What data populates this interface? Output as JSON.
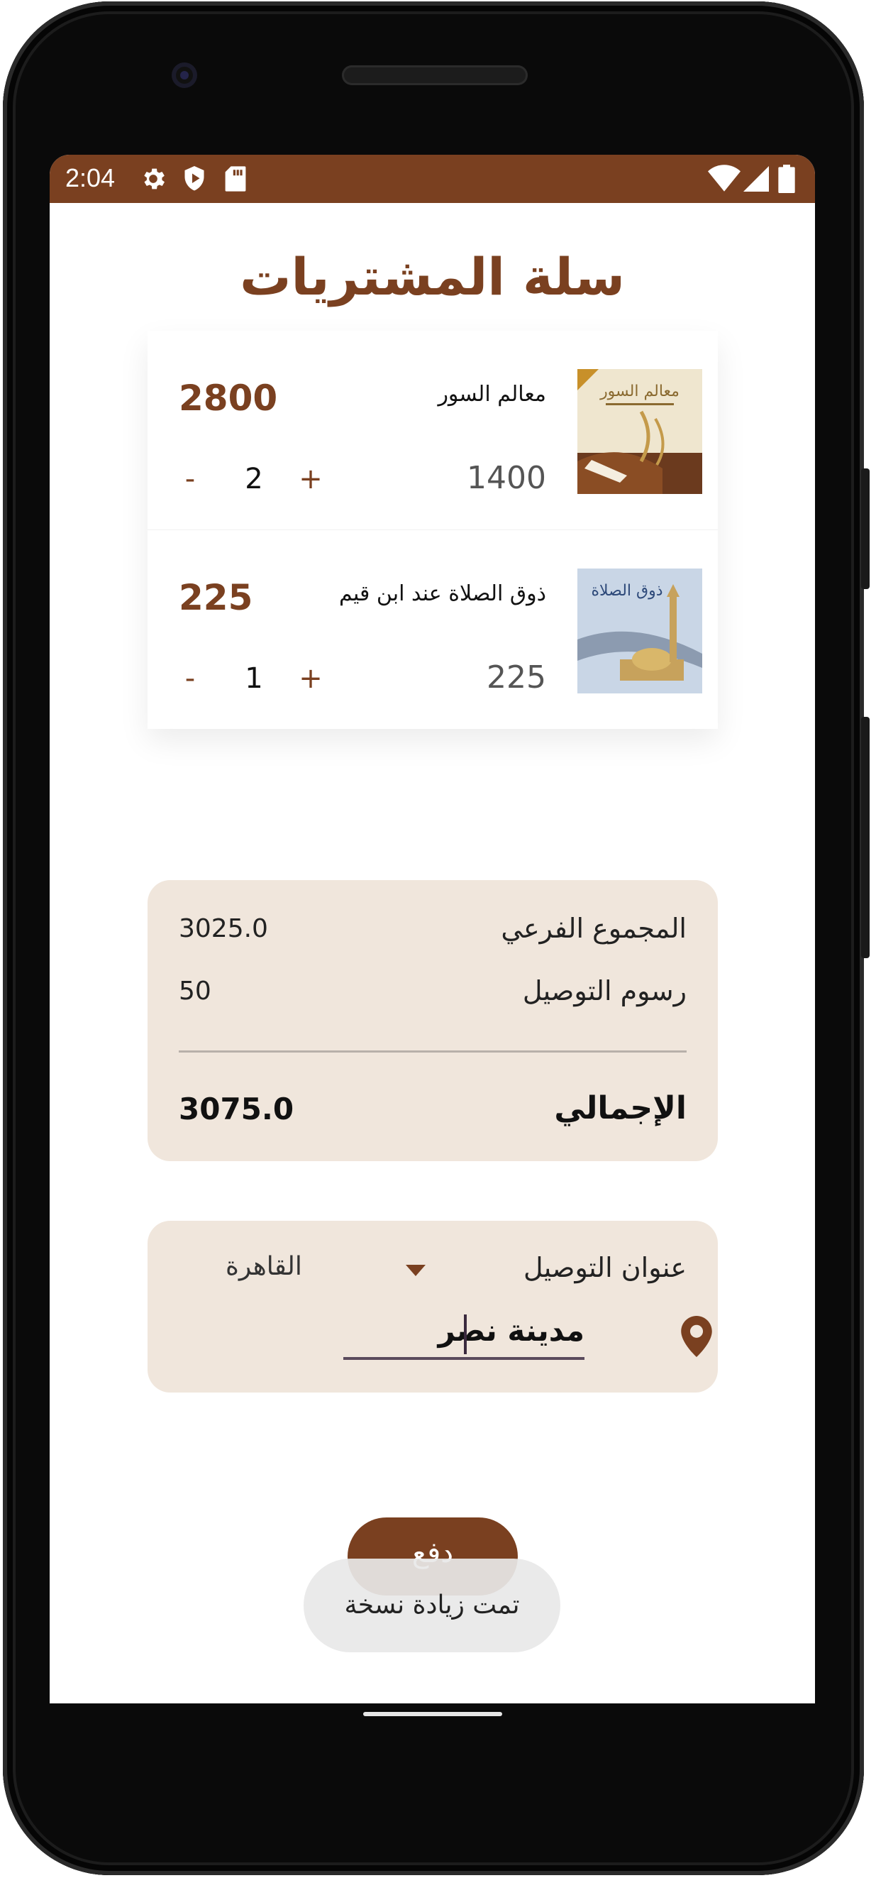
{
  "status_bar": {
    "time": "2:04",
    "left_icons": [
      "gear-icon",
      "shield-icon",
      "sd-card-icon"
    ],
    "right_icons": [
      "wifi-icon",
      "signal-icon",
      "battery-icon"
    ],
    "color": "#7a4020"
  },
  "page": {
    "title": "سلة المشتريات"
  },
  "cart": {
    "items": [
      {
        "title": "معالم السور",
        "unit_price": "1400",
        "quantity": "2",
        "line_total": "2800",
        "minus": "-",
        "plus": "+",
        "cover_text": "معالم السور"
      },
      {
        "title": "ذوق الصلاة عند ابن قيم",
        "unit_price": "225",
        "quantity": "1",
        "line_total": "225",
        "minus": "-",
        "plus": "+",
        "cover_text": "ذوق الصلاة"
      }
    ]
  },
  "summary": {
    "subtotal_label": "المجموع الفرعي",
    "subtotal_value": "3025.0",
    "shipping_label": "رسوم التوصيل",
    "shipping_value": "50",
    "total_label": "الإجمالي",
    "total_value": "3075.0"
  },
  "address": {
    "label": "عنوان التوصيل",
    "city": "القاهرة",
    "street_value": "مدينة نصر"
  },
  "actions": {
    "pay_label": "دفع"
  },
  "toast": {
    "message": "تمت زيادة نسخة"
  },
  "colors": {
    "brand": "#7a4020",
    "card_bg": "#f0e6dc"
  }
}
